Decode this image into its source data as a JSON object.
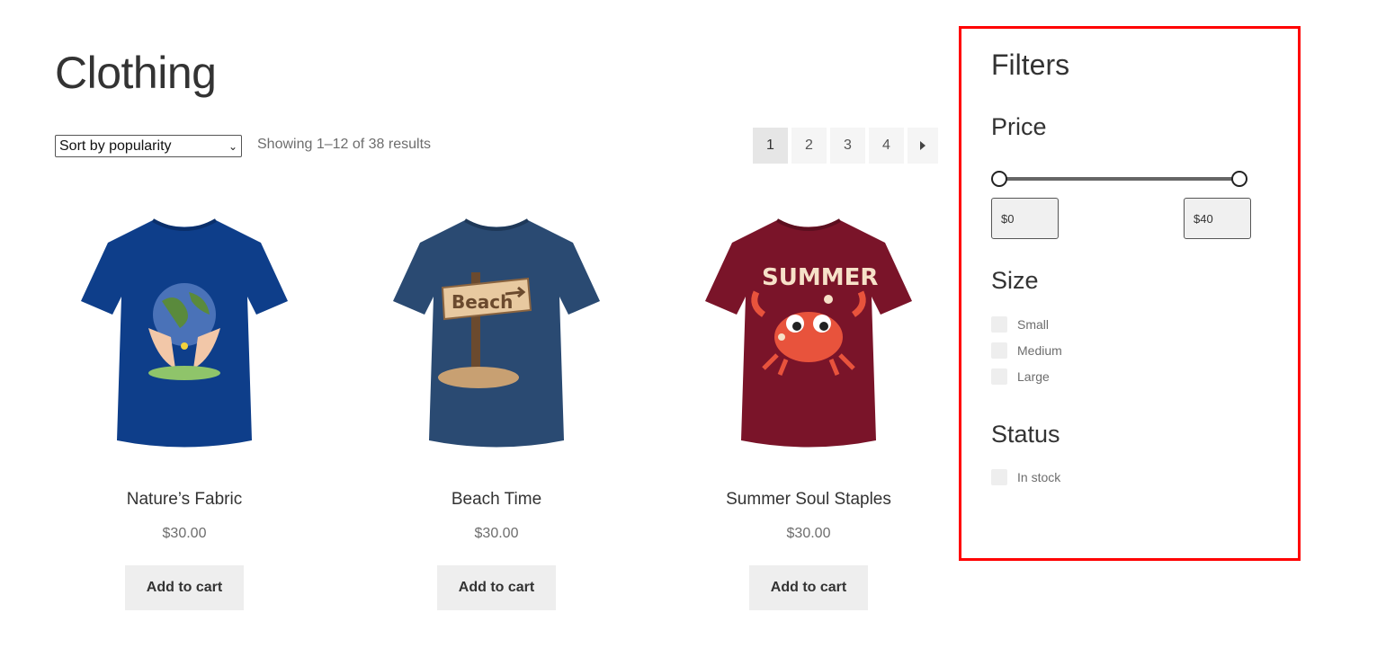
{
  "page": {
    "title": "Clothing"
  },
  "toolbar": {
    "sort_selected": "Sort by popularity",
    "result_count": "Showing 1–12 of 38 results"
  },
  "pagination": {
    "pages": [
      "1",
      "2",
      "3",
      "4"
    ],
    "current": "1",
    "next_icon": "triangle-right-icon"
  },
  "products": [
    {
      "name": "Nature’s Fabric",
      "price": "$30.00",
      "button": "Add to cart",
      "shirt_color": "#0e3e8a",
      "print": "earth-hands"
    },
    {
      "name": "Beach Time",
      "price": "$30.00",
      "button": "Add to cart",
      "shirt_color": "#2a4a72",
      "print": "beach-sign"
    },
    {
      "name": "Summer Soul Staples",
      "price": "$30.00",
      "button": "Add to cart",
      "shirt_color": "#7a1429",
      "print": "summer-crab"
    }
  ],
  "filters": {
    "title": "Filters",
    "price": {
      "heading": "Price",
      "min": "$0",
      "max": "$40",
      "range_fraction": [
        0,
        1
      ]
    },
    "size": {
      "heading": "Size",
      "options": [
        "Small",
        "Medium",
        "Large"
      ]
    },
    "status": {
      "heading": "Status",
      "options": [
        "In stock"
      ]
    },
    "highlight_color": "#ff0000"
  }
}
